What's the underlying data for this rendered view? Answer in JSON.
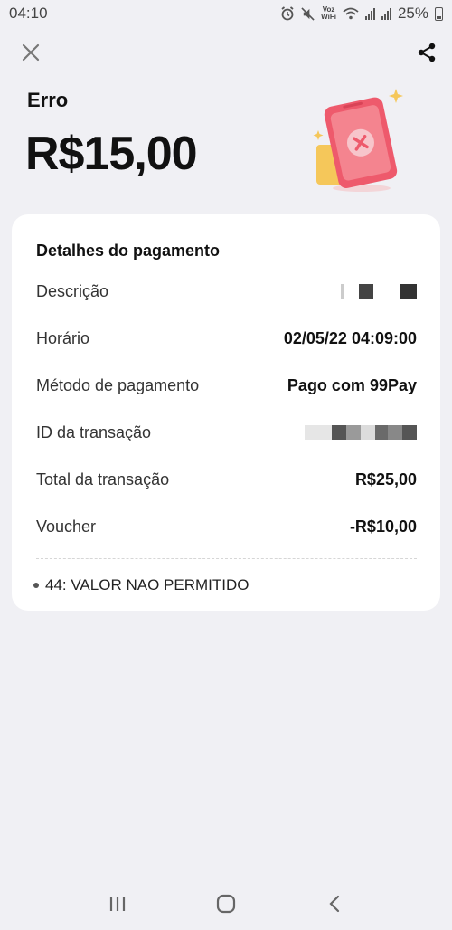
{
  "status_bar": {
    "time": "04:10",
    "volte_top": "Voz",
    "volte_bottom": "WiFi",
    "battery": "25%",
    "icons": [
      "alarm-icon",
      "mute-icon",
      "volte-icon",
      "wifi-icon",
      "signal-icon",
      "signal-icon",
      "battery-icon"
    ]
  },
  "header": {
    "close_icon": "close-icon",
    "share_icon": "share-icon"
  },
  "payment": {
    "status": "Erro",
    "amount": "R$15,00",
    "illustration": "payment-error-illustration"
  },
  "details": {
    "title": "Detalhes do pagamento",
    "rows": [
      {
        "label": "Descrição",
        "value": ""
      },
      {
        "label": "Horário",
        "value": "02/05/22 04:09:00"
      },
      {
        "label": "Método de pagamento",
        "value": "Pago com 99Pay"
      },
      {
        "label": "ID da transação",
        "value": ""
      },
      {
        "label": "Total da transação",
        "value": "R$25,00"
      },
      {
        "label": "Voucher",
        "value": "-R$10,00"
      }
    ],
    "error_message": "44: VALOR NAO PERMITIDO"
  },
  "colors": {
    "background": "#f0f0f4",
    "card": "#ffffff",
    "error_red": "#ee5a6c",
    "accent_yellow": "#f5c75a"
  },
  "nav": {
    "icons": [
      "recents-icon",
      "home-icon",
      "back-icon"
    ]
  }
}
